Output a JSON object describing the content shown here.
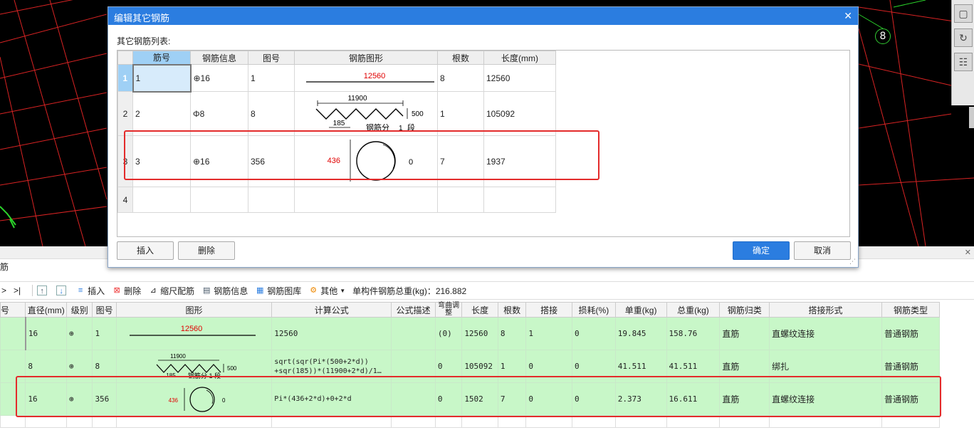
{
  "cad": {
    "axis_bubble": "8"
  },
  "view_toolbar": {
    "icons": [
      "cube-icon",
      "rotate-icon",
      "layers-icon"
    ]
  },
  "panel": {
    "title": "筋",
    "tab": "号"
  },
  "toolbar": {
    "nav_next": ">",
    "nav_last": ">|",
    "insert": "插入",
    "delete": "删除",
    "scale": "缩尺配筋",
    "rebar_info": "钢筋信息",
    "rebar_library": "钢筋图库",
    "other": "其他",
    "total_weight": "单构件钢筋总重(kg)：216.882"
  },
  "main_grid": {
    "headers": [
      "号",
      "直径(mm)",
      "级别",
      "图号",
      "图形",
      "计算公式",
      "公式描述",
      "弯曲调整",
      "长度",
      "根数",
      "搭接",
      "损耗(%)",
      "单重(kg)",
      "总重(kg)",
      "钢筋归类",
      "搭接形式",
      "钢筋类型"
    ],
    "rows": [
      {
        "no": "",
        "diameter": "16",
        "grade": "⊕",
        "fig_no": "1",
        "shape_len": "12560",
        "formula": "12560",
        "formula2": "",
        "desc": "",
        "bend": "(0)",
        "length": "12560",
        "count": "8",
        "lap": "1",
        "loss": "0",
        "unit_wt": "19.845",
        "total_wt": "158.76",
        "category": "直筋",
        "lap_type": "直螺纹连接",
        "rebar_type": "普通钢筋"
      },
      {
        "no": "",
        "diameter": "8",
        "grade": "⊕",
        "fig_no": "8",
        "shape_top": "11900",
        "shape_side": "500",
        "shape_small": "185",
        "shape_label": "钢筋分 1 段",
        "formula": "sqrt(sqr(Pi*(500+2*d))",
        "formula2": "+sqr(185))*(11900+2*d)/1…",
        "desc": "",
        "bend": "0",
        "length": "105092",
        "count": "1",
        "lap": "0",
        "loss": "0",
        "unit_wt": "41.511",
        "total_wt": "41.511",
        "category": "直筋",
        "lap_type": "绑扎",
        "rebar_type": "普通钢筋"
      },
      {
        "no": "",
        "diameter": "16",
        "grade": "⊕",
        "fig_no": "356",
        "shape_dia": "436",
        "shape_gap": "0",
        "formula": "Pi*(436+2*d)+0+2*d",
        "formula2": "",
        "desc": "",
        "bend": "0",
        "length": "1502",
        "count": "7",
        "lap": "0",
        "loss": "0",
        "unit_wt": "2.373",
        "total_wt": "16.611",
        "category": "直筋",
        "lap_type": "直螺纹连接",
        "rebar_type": "普通钢筋"
      }
    ]
  },
  "dialog": {
    "title": "编辑其它钢筋",
    "list_label": "其它钢筋列表:",
    "headers": [
      "筋号",
      "钢筋信息",
      "图号",
      "钢筋图形",
      "根数",
      "长度(mm)"
    ],
    "rows": [
      {
        "rn": "1",
        "no": "1",
        "info": "⊕16",
        "fig": "1",
        "shape_len": "12560",
        "count": "8",
        "length": "12560"
      },
      {
        "rn": "2",
        "no": "2",
        "info": "Φ8",
        "fig": "8",
        "shape_top": "11900",
        "shape_side": "500",
        "shape_small": "185",
        "shape_label": "钢筋分",
        "shape_num": "1",
        "shape_seg": "段",
        "count": "1",
        "length": "105092"
      },
      {
        "rn": "3",
        "no": "3",
        "info": "⊕16",
        "fig": "356",
        "shape_dia": "436",
        "shape_gap": "0",
        "count": "7",
        "length": "1937"
      },
      {
        "rn": "4",
        "no": "",
        "info": "",
        "fig": "",
        "count": "",
        "length": ""
      }
    ],
    "buttons": {
      "insert": "插入",
      "delete": "删除",
      "ok": "确定",
      "cancel": "取消"
    }
  },
  "colors": {
    "accent": "#2b7de0",
    "highlight": "#e32b2b",
    "row_green": "#c8f7c8",
    "dim_red": "#e00000"
  }
}
